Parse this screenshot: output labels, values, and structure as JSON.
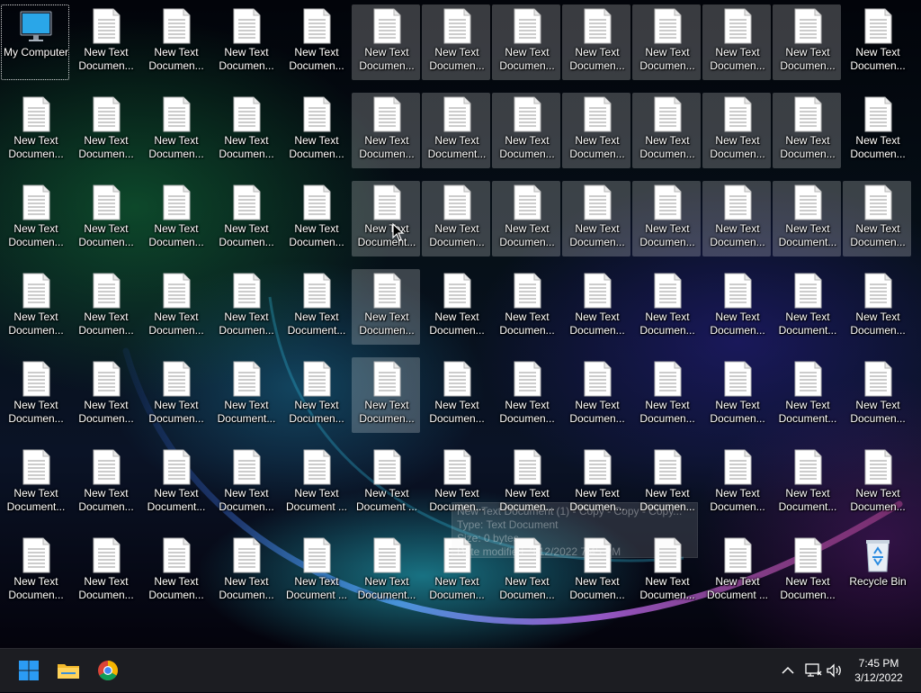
{
  "desktop": {
    "columns": 13,
    "rows": 7,
    "my_computer_label": "My Computer",
    "recycle_bin_label": "Recycle Bin",
    "doc_line1": "New Text",
    "doc_labels": [
      [
        "",
        "Documen...",
        "Documen...",
        "Documen...",
        "Documen...",
        "Documen...",
        "Documen...",
        "Documen...",
        "Documen...",
        "Documen...",
        "Documen...",
        "Documen...",
        "Documen..."
      ],
      [
        "Documen...",
        "Documen...",
        "Documen...",
        "Documen...",
        "Documen...",
        "Documen...",
        "Document...",
        "Documen...",
        "Documen...",
        "Documen...",
        "Documen...",
        "Documen...",
        "Documen..."
      ],
      [
        "Documen...",
        "Documen...",
        "Documen...",
        "Documen...",
        "Documen...",
        "Document...",
        "Documen...",
        "Documen...",
        "Documen...",
        "Documen...",
        "Documen...",
        "Document...",
        "Documen..."
      ],
      [
        "Documen...",
        "Documen...",
        "Documen...",
        "Documen...",
        "Document...",
        "Documen...",
        "Documen...",
        "Documen...",
        "Documen...",
        "Documen...",
        "Documen...",
        "Document...",
        "Documen..."
      ],
      [
        "Documen...",
        "Documen...",
        "Documen...",
        "Document...",
        "Documen...",
        "Documen...",
        "Documen...",
        "Documen...",
        "Documen...",
        "Documen...",
        "Documen...",
        "Document...",
        "Documen..."
      ],
      [
        "Document...",
        "Documen...",
        "Document...",
        "Documen...",
        "Document ...",
        "Document ...",
        "Documen...",
        "Documen...",
        "Documen...",
        "Documen...",
        "Documen...",
        "Document...",
        "Documen..."
      ],
      [
        "Documen...",
        "Documen...",
        "Documen...",
        "Documen...",
        "Document ...",
        "Document...",
        "Documen...",
        "Documen...",
        "Documen...",
        "Documen...",
        "Document ...",
        "Documen...",
        ""
      ]
    ],
    "selected": [
      [
        0,
        5
      ],
      [
        0,
        6
      ],
      [
        0,
        7
      ],
      [
        0,
        8
      ],
      [
        0,
        9
      ],
      [
        0,
        10
      ],
      [
        0,
        11
      ],
      [
        1,
        5
      ],
      [
        1,
        6
      ],
      [
        1,
        7
      ],
      [
        1,
        8
      ],
      [
        1,
        9
      ],
      [
        1,
        10
      ],
      [
        1,
        11
      ],
      [
        2,
        5
      ],
      [
        2,
        6
      ],
      [
        2,
        7
      ],
      [
        2,
        8
      ],
      [
        2,
        9
      ],
      [
        2,
        10
      ],
      [
        2,
        11
      ],
      [
        2,
        12
      ],
      [
        3,
        5
      ],
      [
        4,
        5
      ]
    ]
  },
  "tooltip": {
    "line1": "New Text Document (1) - Copy - Copy - Copy...",
    "line2": "Type: Text Document",
    "line3": "Size: 0 bytes",
    "line4": "Date modified: 3/12/2022 7:45 PM"
  },
  "taskbar": {
    "start_icon": "windows-start-icon",
    "pinned": [
      "file-explorer-icon",
      "chrome-icon"
    ],
    "tray": [
      "chevron-up-icon",
      "network-icon",
      "volume-icon"
    ],
    "clock": {
      "time": "7:45 PM",
      "date": "3/12/2022"
    },
    "colors": {
      "background": "#1c1d22",
      "accent": "#1e90ff"
    }
  }
}
